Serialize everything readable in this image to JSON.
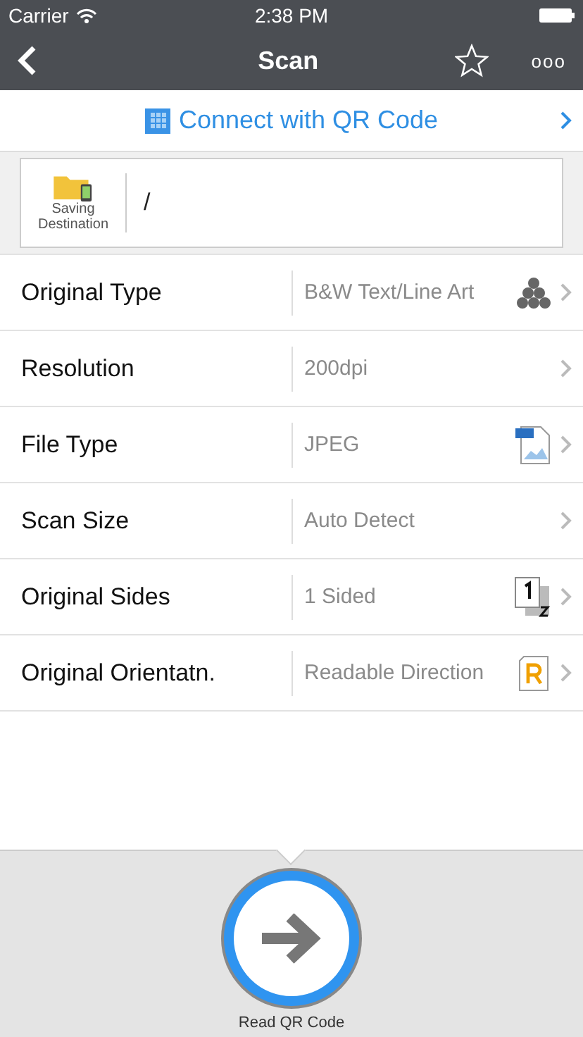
{
  "status_bar": {
    "carrier": "Carrier",
    "time": "2:38 PM"
  },
  "nav": {
    "title": "Scan",
    "more": "ooo"
  },
  "qr_banner": {
    "label": "Connect with QR Code"
  },
  "destination": {
    "label": "Saving Destination",
    "path": "/"
  },
  "settings": [
    {
      "label": "Original Type",
      "value": "B&W Text/Line Art",
      "kind": "halftone"
    },
    {
      "label": "Resolution",
      "value": "200dpi",
      "kind": "plain"
    },
    {
      "label": "File Type",
      "value": "JPEG",
      "kind": "jpg"
    },
    {
      "label": "Scan Size",
      "value": "Auto Detect",
      "kind": "plain"
    },
    {
      "label": "Original Sides",
      "value": "1 Sided",
      "kind": "duplex"
    },
    {
      "label": "Original Orientatn.",
      "value": "Readable Direction",
      "kind": "orientation"
    }
  ],
  "bottom": {
    "button_label": "Read QR Code"
  }
}
